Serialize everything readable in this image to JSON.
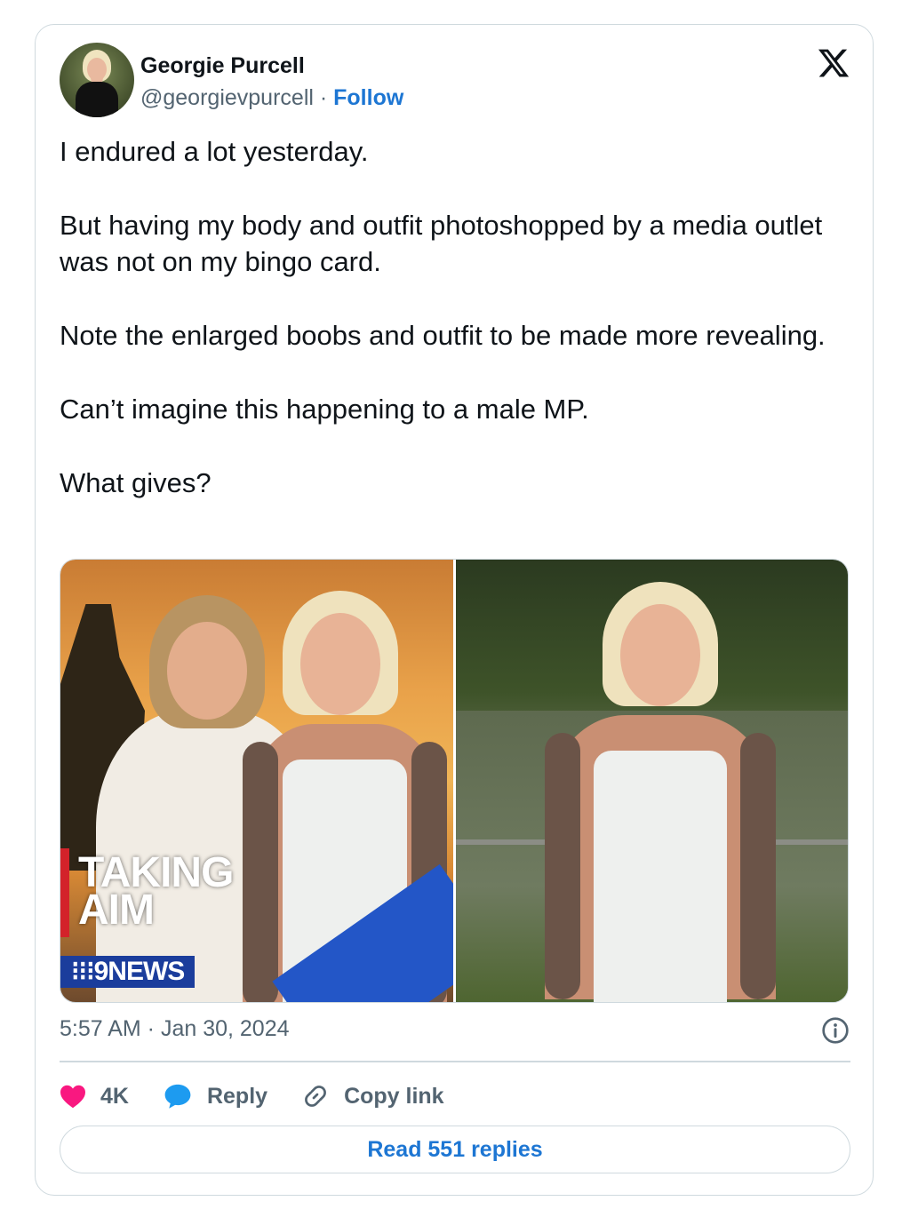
{
  "author": {
    "name": "Georgie Purcell",
    "handle": "@georgievpurcell",
    "separator": " · ",
    "follow_label": "Follow"
  },
  "tweet": {
    "paragraphs": [
      "I endured a lot yesterday.",
      "But having my body and outfit photoshopped by a media outlet was not on my bingo card.",
      "Note the enlarged boobs and outfit to be made more revealing.",
      "Can’t imagine this happening to a male MP.",
      "What gives?"
    ]
  },
  "media": {
    "left_overlay": {
      "headline_line1": "TAKING",
      "headline_line2": "AIM",
      "news_logo": "⁝⁝⁝9NEWS"
    }
  },
  "meta": {
    "timestamp": "5:57 AM · Jan 30, 2024"
  },
  "actions": {
    "like_count": "4K",
    "reply_label": "Reply",
    "copy_link_label": "Copy link"
  },
  "read_replies_label": "Read 551 replies",
  "icons": [
    "x-logo-icon",
    "heart-icon",
    "reply-bubble-icon",
    "link-icon",
    "info-icon"
  ],
  "colors": {
    "link_blue": "#1d76d3",
    "like_pink": "#f91880",
    "reply_blue": "#1d9bf0",
    "muted_text": "#536471",
    "border": "#cfd9de"
  }
}
